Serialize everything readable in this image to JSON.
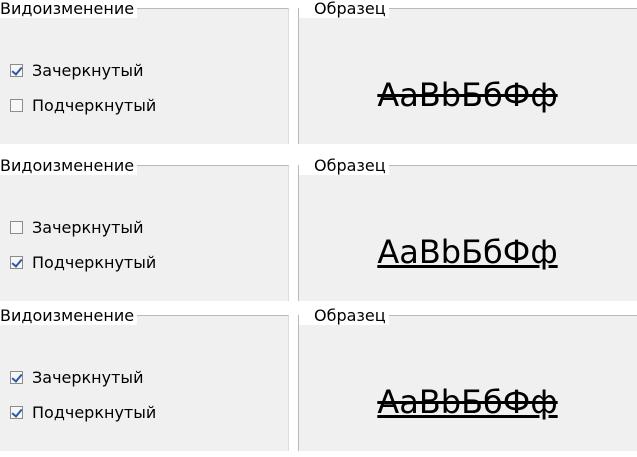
{
  "panels": [
    {
      "group_title": "Видоизменение",
      "sample_title": "Образец",
      "checkboxes": [
        {
          "label": "Зачеркнутый",
          "checked": true
        },
        {
          "label": "Подчеркнутый",
          "checked": false
        }
      ],
      "sample_text": "AaBbБбФф",
      "sample_style": "strike"
    },
    {
      "group_title": "Видоизменение",
      "sample_title": "Образец",
      "checkboxes": [
        {
          "label": "Зачеркнутый",
          "checked": false
        },
        {
          "label": "Подчеркнутый",
          "checked": true
        }
      ],
      "sample_text": "AaBbБбФф",
      "sample_style": "underline"
    },
    {
      "group_title": "Видоизменение",
      "sample_title": "Образец",
      "checkboxes": [
        {
          "label": "Зачеркнутый",
          "checked": true
        },
        {
          "label": "Подчеркнутый",
          "checked": true
        }
      ],
      "sample_text": "AaBbБбФф",
      "sample_style": "both"
    }
  ],
  "colors": {
    "panel_bg": "#f0f0f0",
    "check_mark": "#2a57a8",
    "frame_line": "#b9b9b9"
  }
}
